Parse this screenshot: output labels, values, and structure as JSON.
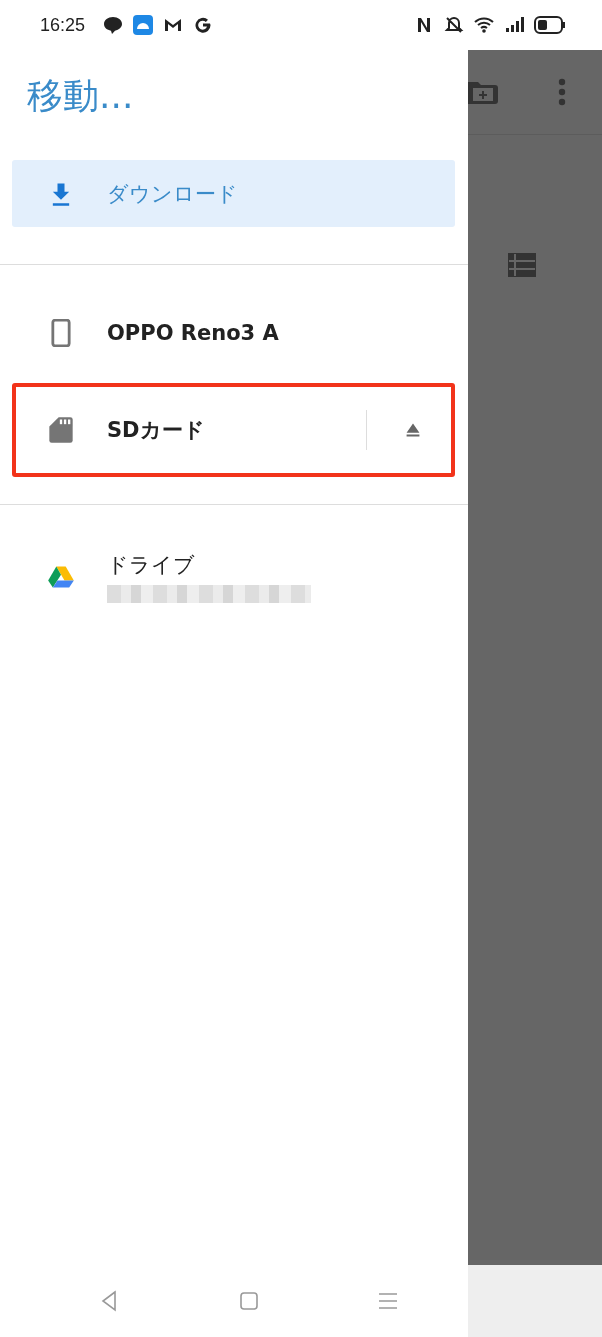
{
  "status_bar": {
    "time": "16:25"
  },
  "title": "移動...",
  "sections": [
    {
      "items": [
        {
          "kind": "download",
          "label": "ダウンロード",
          "selected": true
        }
      ]
    },
    {
      "items": [
        {
          "kind": "device",
          "label": "OPPO Reno3 A",
          "selected": false
        },
        {
          "kind": "sd",
          "label": "SDカード",
          "selected": false,
          "highlighted": true,
          "eject": true
        }
      ]
    },
    {
      "items": [
        {
          "kind": "drive",
          "label": "ドライブ",
          "selected": false,
          "redacted_subtitle": true
        }
      ]
    }
  ]
}
